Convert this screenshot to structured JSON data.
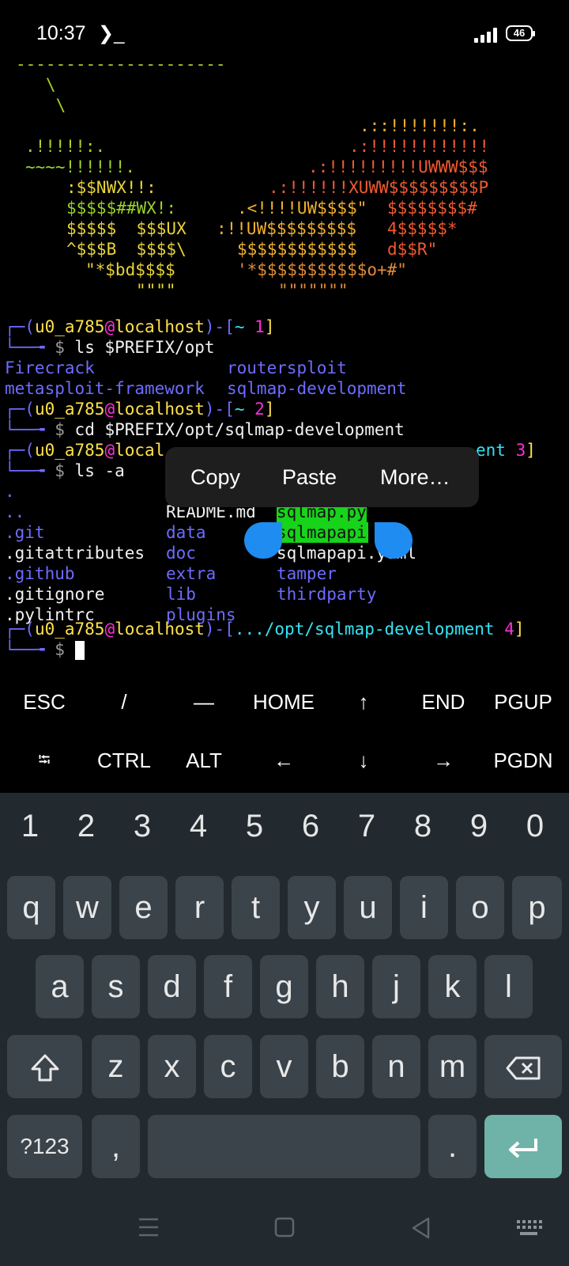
{
  "status_bar": {
    "time": "10:37",
    "terminal_indicator": "❯_",
    "battery": "46"
  },
  "terminal": {
    "dashes": "---------------------",
    "bs1": "   \\",
    "bs2": "    \\",
    "art": {
      "l1r": ".::!!!!!!!:.",
      "l2l": ".!!!!!:.",
      "l2r": ".:!!!!!!!!!!!!",
      "l3l": "~~~~!!!!!!.",
      "l3r": ".:!!!!!!!!!UWWW$$$",
      "l4l": ":$$NWX!!:",
      "l4r": ".:!!!!!!XUWW$$$$$$$$$P",
      "l5l": "$$$$$##WX!:",
      "l5r": ".<!!!!UW$$$$\"",
      "l5r2": "$$$$$$$$#",
      "l6l": "$$$$$  $$$UX",
      "l6r": ":!!UW$$$$$$$$$",
      "l6r2": "4$$$$$*",
      "l7l": "^$$$B  $$$$\\",
      "l7r": "$$$$$$$$$$$$",
      "l7r2": "d$$R\"",
      "l8l": "\"*$bd$$$$",
      "l8r": "'*$$$$$$$$$$$o+#\"",
      "l9l": "\"\"\"\"",
      "l9r": "\"\"\"\"\"\"\""
    },
    "prompt_corner": "┌─(",
    "prompt_user": "u0_a785",
    "prompt_at": "@",
    "prompt_host": "localhost",
    "prompt_close": ")-[",
    "prompt_corner_bottom": "└──╼",
    "dollar": "$",
    "p1_path": "~",
    "p1_num": "1",
    "cmd1": "ls $PREFIX/opt",
    "ls1": {
      "a": "Firecrack",
      "b": "routersploit",
      "c": "metasploit-framework",
      "d": "sqlmap-development"
    },
    "p2_path": "~",
    "p2_num": "2",
    "cmd2": "cd $PREFIX/opt/sqlmap-development",
    "p3_user_partial": "u0_a785",
    "p3_host_partial": "local",
    "p3_tail": "ent",
    "p3_num": "3",
    "cmd3": "ls -a",
    "ls2": {
      "dot": ".",
      "dotdot": "..",
      "git": ".git",
      "gitattributes": ".gitattributes",
      "github": ".github",
      "gitignore": ".gitignore",
      "pylintrc": ".pylintrc",
      "readme": "README.md",
      "data": "data",
      "doc": "doc",
      "extra": "extra",
      "lib": "lib",
      "plugins": "plugins",
      "sqlmap": "sqlmap.py",
      "sqlmapapi": "sqlmapapi",
      "sqlmapapi_yaml_tail": ".yaml",
      "sqlmapapi_yaml_head": "sqlmapapi",
      "tamper": "tamper",
      "thirdparty": "thirdparty"
    },
    "p4_path": ".../opt/sqlmap-development",
    "p4_num": "4",
    "bracket_close": "]"
  },
  "context_menu": {
    "copy": "Copy",
    "paste": "Paste",
    "more": "More…"
  },
  "extra_keys": {
    "row1": [
      "ESC",
      "/",
      "—",
      "HOME",
      "↑",
      "END",
      "PGUP"
    ],
    "row2": [
      "⭾",
      "CTRL",
      "ALT",
      "←",
      "↓",
      "→",
      "PGDN"
    ]
  },
  "keyboard": {
    "numbers": [
      "1",
      "2",
      "3",
      "4",
      "5",
      "6",
      "7",
      "8",
      "9",
      "0"
    ],
    "row1": [
      "q",
      "w",
      "e",
      "r",
      "t",
      "y",
      "u",
      "i",
      "o",
      "p"
    ],
    "row2": [
      "a",
      "s",
      "d",
      "f",
      "g",
      "h",
      "j",
      "k",
      "l"
    ],
    "row3": [
      "z",
      "x",
      "c",
      "v",
      "b",
      "n",
      "m"
    ],
    "symbols_key": "?123",
    "comma": ",",
    "period": ".",
    "accent_color": "#6fb3a8"
  }
}
